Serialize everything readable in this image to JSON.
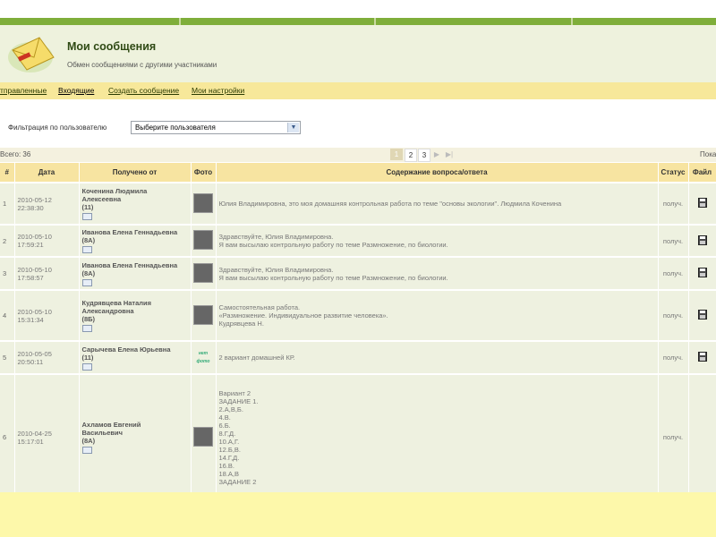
{
  "header": {
    "title": "Мои сообщения",
    "subtitle": "Обмен сообщениями с другими участниками"
  },
  "nav": {
    "sent": "тправленные",
    "inbox": "Входящие",
    "create": "Создать сообщение",
    "settings": "Мои настройки"
  },
  "filter": {
    "label": "Фильтрация по пользователю",
    "selected": "Выберите пользователя"
  },
  "info": {
    "total": "Всего: 36",
    "show": "Пока",
    "pages": [
      "1",
      "2",
      "3"
    ],
    "current_page": "1"
  },
  "table": {
    "columns": [
      "#",
      "Дата",
      "Получено от",
      "Фото",
      "Содержание вопроса/ответа",
      "Статус",
      "Файл"
    ],
    "rows": [
      {
        "num": "1",
        "date": "2010-05-12",
        "time": "22:38:30",
        "name1": "Коченина Людмила",
        "name2": "Алексеевна",
        "group": "(11)",
        "photo": "photo",
        "msg": [
          "Юлия Владимировна, это моя домашняя контрольная работа по теме \"основы экологии\". Людмила Коченина"
        ],
        "status": "получ.",
        "file": true
      },
      {
        "num": "2",
        "date": "2010-05-10",
        "time": "17:59:21",
        "name1": "Иванова Елена Геннадьевна",
        "name2": "",
        "group": "(8А)",
        "photo": "photo",
        "msg": [
          "Здравствуйте, Юлия Владимировна.",
          "Я вам высылаю контрольную работу по теме Размножение, по биологии."
        ],
        "status": "получ.",
        "file": true
      },
      {
        "num": "3",
        "date": "2010-05-10",
        "time": "17:58:57",
        "name1": "Иванова Елена Геннадьевна",
        "name2": "",
        "group": "(8А)",
        "photo": "photo",
        "msg": [
          "Здравствуйте, Юлия Владимировна.",
          "Я вам высылаю контрольную работу по теме Размножение, по биологии."
        ],
        "status": "получ.",
        "file": true
      },
      {
        "num": "4",
        "date": "2010-05-10",
        "time": "15:31:34",
        "name1": "Кудрявцева Наталия",
        "name2": "Александровна",
        "group": "(8Б)",
        "photo": "photo",
        "msg": [
          "Самостоятельная работа.",
          "«Размножение. Индивидуальное развитие человека».",
          "Кудрявцева Н."
        ],
        "status": "получ.",
        "file": true
      },
      {
        "num": "5",
        "date": "2010-05-05",
        "time": "20:50:11",
        "name1": "Сарычева Елена Юрьевна",
        "name2": "",
        "group": "(11)",
        "photo": "nofoto",
        "nofoto_text": "нет фото",
        "msg": [
          "2 вариант домашней КР."
        ],
        "status": "получ.",
        "file": true
      },
      {
        "num": "6",
        "date": "2010-04-25",
        "time": "15:17:01",
        "name1": "Ахламов Евгений",
        "name2": "Васильевич",
        "group": "(8А)",
        "photo": "photo",
        "msg": [
          "Вариант 2",
          "ЗАДАНИЕ 1.",
          "2.А,В,Б.",
          "4.В.",
          "6.Б.",
          "8.Г,Д.",
          "10.А,Г.",
          "12.Б,В.",
          "14.Г,Д.",
          "16.В.",
          "18.А,В",
          "ЗАДАНИЕ 2"
        ],
        "status": "получ.",
        "file": false
      }
    ]
  },
  "colors": {
    "accent_green": "#7fae3a",
    "header_bg": "#eef2dd",
    "nav_bg": "#f7e89a",
    "table_header_bg": "#f7e4a1",
    "row_bg": "#eef1e0",
    "bottom_bg": "#fdf8aa"
  }
}
